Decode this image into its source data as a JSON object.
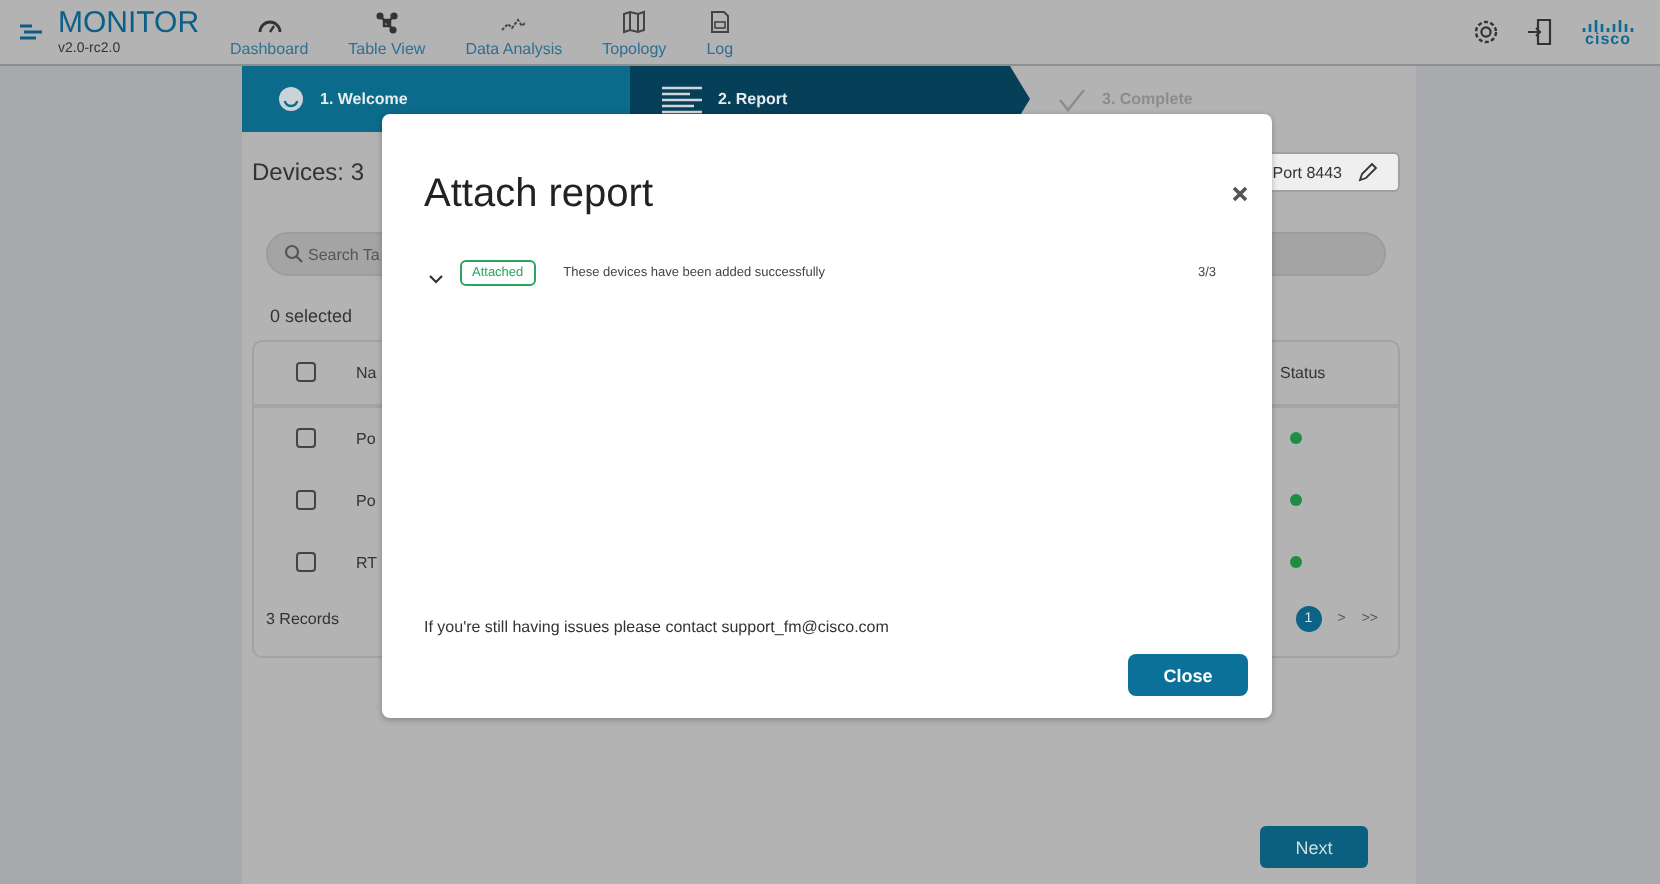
{
  "app": {
    "title": "MONITOR",
    "version": "v2.0-rc2.0",
    "logo": "cisco"
  },
  "nav": [
    {
      "label": "Dashboard",
      "kind": "gauge"
    },
    {
      "label": "Table View",
      "kind": "nodes"
    },
    {
      "label": "Data Analysis",
      "kind": "chart"
    },
    {
      "label": "Topology",
      "kind": "map"
    },
    {
      "label": "Log",
      "kind": "log"
    }
  ],
  "steps": [
    {
      "label": "1. Welcome",
      "completed": true,
      "selected": false
    },
    {
      "label": "2. Report",
      "completed": false,
      "selected": true
    },
    {
      "label": "3. Complete",
      "completed": false,
      "selected": false
    }
  ],
  "devices_title": "Devices: 3",
  "port": "Port 8443",
  "search": {
    "placeholder": "Search Ta"
  },
  "selected_count": "0 selected",
  "table": {
    "columns": [
      "Na",
      "Status"
    ],
    "header_checked": false,
    "rows": [
      {
        "name": "Po",
        "checked": false,
        "color": "#1f8d43"
      },
      {
        "name": "Po",
        "checked": false,
        "color": "#1f8d43"
      },
      {
        "name": "RT",
        "checked": false,
        "color": "#1f8d43"
      }
    ]
  },
  "records": "3 Records",
  "pager": {
    "pages": [
      {
        "label": "1",
        "selected": true
      }
    ],
    "next": ">",
    "last": ">>"
  },
  "next_button": "Next",
  "dialog": {
    "title": "Attach report",
    "items": [
      {
        "status": "Attached",
        "message": "These devices have been added successfully",
        "count": "3/3",
        "expanded": false
      }
    ],
    "footer": "If you're still having issues please contact support_fm@cisco.com",
    "button": "Close"
  }
}
